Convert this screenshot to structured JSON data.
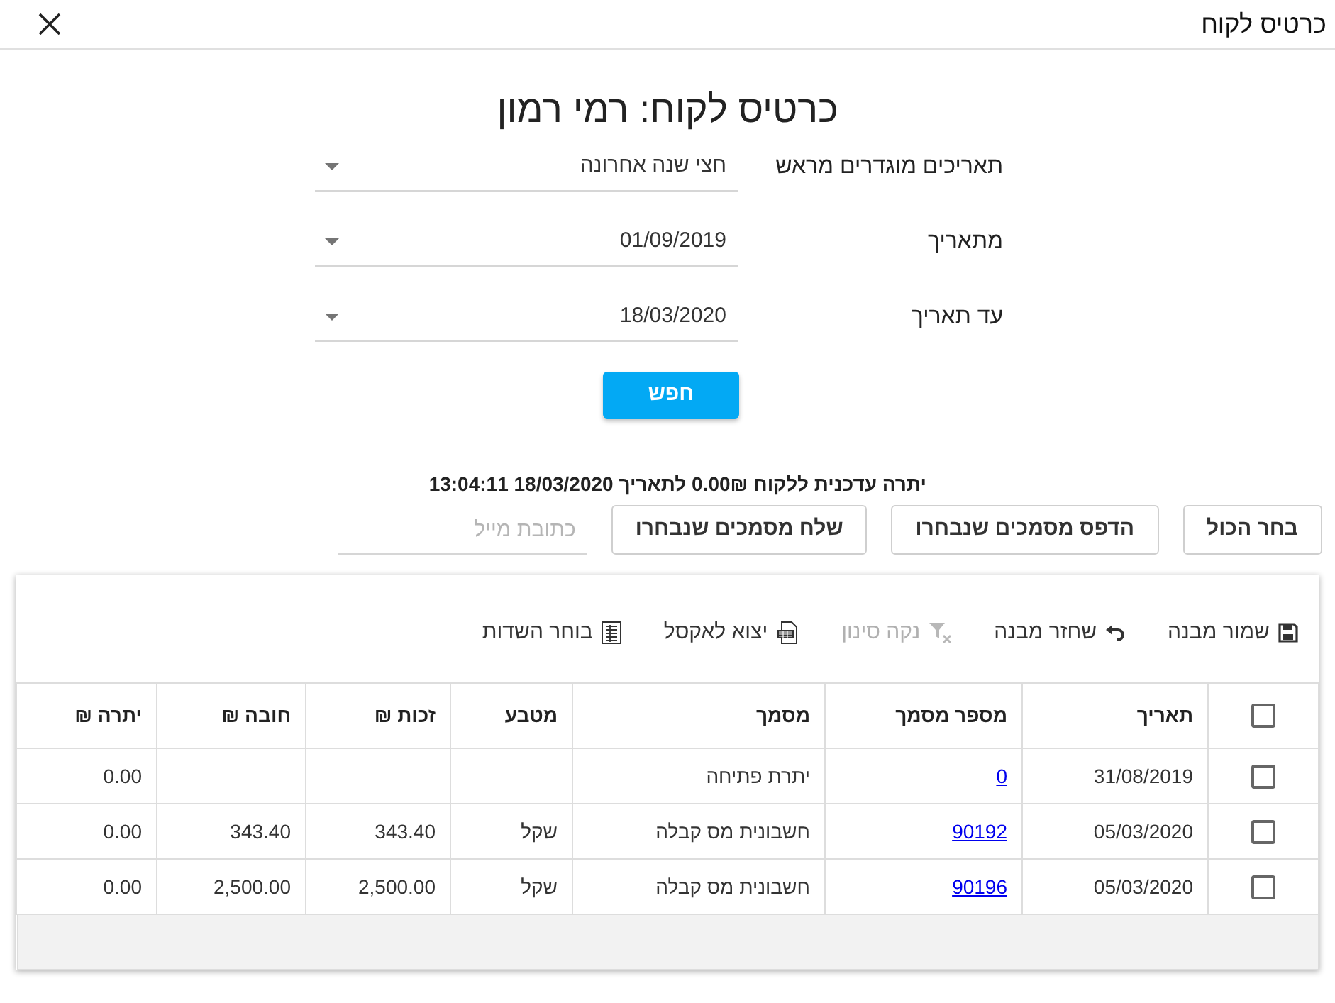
{
  "window": {
    "title": "כרטיס לקוח"
  },
  "heading": "כרטיס לקוח: רמי רמון",
  "filters": [
    {
      "label": "תאריכים מוגדרים מראש",
      "value": "חצי שנה אחרונה"
    },
    {
      "label": "מתאריך",
      "value": "01/09/2019"
    },
    {
      "label": "עד תאריך",
      "value": "18/03/2020"
    }
  ],
  "search_button": "חפש",
  "balance_summary": "יתרה עדכנית ללקוח 0.00₪ לתאריך 18/03/2020 13:04:11",
  "actions": [
    "בחר הכול",
    "הדפס מסמכים שנבחרו",
    "שלח מסמכים שנבחרו"
  ],
  "email_field": {
    "placeholder": "כתובת מייל"
  },
  "toolbar": [
    {
      "label": "שמור מבנה",
      "disabled": false
    },
    {
      "label": "שחזר מבנה",
      "disabled": false
    },
    {
      "label": "נקה סינון",
      "disabled": true
    },
    {
      "label": "יצוא לאקסל",
      "disabled": false
    },
    {
      "label": "בוחר השדות",
      "disabled": false
    }
  ],
  "table": {
    "select_all": {
      "checked": false
    },
    "columns": [
      "תאריך",
      "מספר מסמך",
      "מסמך",
      "מטבע",
      "זכות ₪",
      "חובה ₪",
      "יתרה ₪"
    ],
    "rows": [
      {
        "checked": false,
        "date": "31/08/2019",
        "doc_number": "0",
        "document": "יתרת פתיחה",
        "balance": "0.00"
      },
      {
        "checked": false,
        "date": "05/03/2020",
        "doc_number": "90192",
        "document": "חשבונית מס קבלה",
        "currency": "שקל",
        "credit": "343.40",
        "debit": "343.40",
        "balance": "0.00"
      },
      {
        "checked": false,
        "date": "05/03/2020",
        "doc_number": "90196",
        "document": "חשבונית מס קבלה",
        "currency": "שקל",
        "credit": "2,500.00",
        "debit": "2,500.00",
        "balance": "0.00"
      }
    ]
  }
}
